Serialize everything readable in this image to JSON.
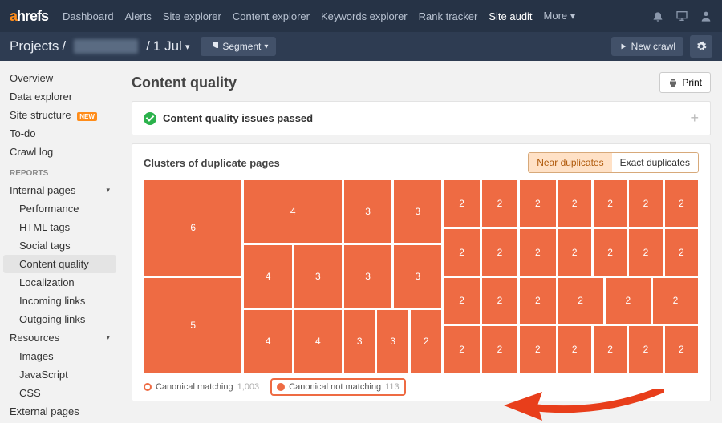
{
  "topnav": {
    "logo_a": "a",
    "logo_rest": "hrefs",
    "items": [
      "Dashboard",
      "Alerts",
      "Site explorer",
      "Content explorer",
      "Keywords explorer",
      "Rank tracker",
      "Site audit",
      "More"
    ],
    "active_index": 6
  },
  "subnav": {
    "projects": "Projects",
    "sep": "/",
    "date": "1 Jul",
    "segment": "Segment",
    "newcrawl": "New crawl"
  },
  "sidebar": {
    "items": [
      {
        "label": "Overview"
      },
      {
        "label": "Data explorer"
      },
      {
        "label": "Site structure",
        "badge": "NEW"
      },
      {
        "label": "To-do"
      },
      {
        "label": "Crawl log"
      }
    ],
    "reports_heading": "REPORTS",
    "reports": [
      {
        "label": "Internal pages",
        "expand": true,
        "children": [
          {
            "label": "Performance"
          },
          {
            "label": "HTML tags"
          },
          {
            "label": "Social tags"
          },
          {
            "label": "Content quality",
            "active": true
          },
          {
            "label": "Localization"
          },
          {
            "label": "Incoming links"
          },
          {
            "label": "Outgoing links"
          }
        ]
      },
      {
        "label": "Resources",
        "expand": true,
        "children": [
          {
            "label": "Images"
          },
          {
            "label": "JavaScript"
          },
          {
            "label": "CSS"
          }
        ]
      },
      {
        "label": "External pages"
      }
    ]
  },
  "content": {
    "title": "Content quality",
    "print": "Print",
    "passed": "Content quality issues passed",
    "clusters_title": "Clusters of duplicate pages",
    "toggles": {
      "near": "Near duplicates",
      "exact": "Exact duplicates"
    },
    "legend": {
      "canonical_matching": "Canonical matching",
      "canonical_matching_count": "1,003",
      "canonical_not_matching": "Canonical not matching",
      "canonical_not_matching_count": "113"
    }
  },
  "chart_data": {
    "type": "treemap",
    "title": "Clusters of duplicate pages",
    "unit": "pages",
    "values": [
      6,
      5,
      4,
      4,
      3,
      4,
      4,
      3,
      3,
      3,
      3,
      3,
      3,
      2,
      2,
      2,
      2,
      2,
      2,
      2,
      2,
      2,
      2,
      2,
      2,
      2,
      2,
      2,
      2,
      2,
      2,
      2,
      2,
      2,
      2,
      2,
      2,
      2,
      2,
      2,
      2
    ],
    "color": "#ee6b43"
  }
}
